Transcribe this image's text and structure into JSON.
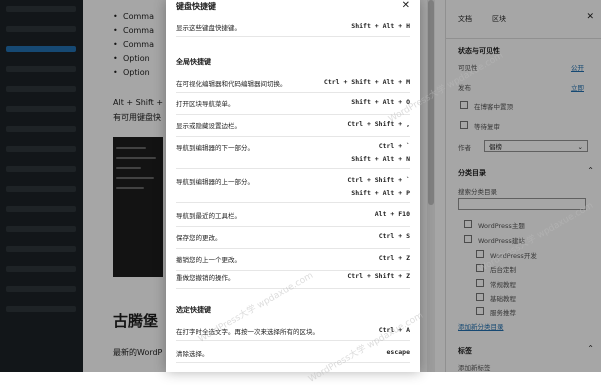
{
  "editor": {
    "bullets": [
      "Comma",
      "Comma",
      "Comma",
      "Option",
      "Option"
    ],
    "line1": "Alt + Shift +",
    "line2": "有可用键盘快",
    "heading": "古腾堡",
    "bottom_text": "最新的WordP"
  },
  "settings": {
    "tab_document": "文档",
    "tab_block": "区块",
    "close": "✕",
    "visibility_section": "状态与可见性",
    "visibility_label": "可见性",
    "visibility_value": "公开",
    "publish_label": "发布",
    "publish_value": "立即",
    "sticky_label": "在博客中置顶",
    "pending_label": "等待复审",
    "author_label": "作者",
    "author_value": "倡榜",
    "categories_section": "分类目录",
    "search_categories": "搜索分类目录",
    "categories": [
      "WordPress主题",
      "WordPress建站",
      "WordPress开发",
      "后台定制",
      "常规教程",
      "基础教程",
      "服务推荐"
    ],
    "add_category": "添加新分类目录",
    "tags_section": "标签",
    "add_tag": "添加新标签"
  },
  "modal": {
    "title": "键盘快捷键",
    "close": "✕",
    "top_shortcut": {
      "desc": "显示这些键盘快捷键。",
      "keys": "Shift + Alt + H"
    },
    "global_section": "全局快捷键",
    "global": [
      {
        "desc": "在可视化编辑器和代码编辑器间切换。",
        "keys": "Ctrl + Shift + Alt + M"
      },
      {
        "desc": "打开区块导航菜单。",
        "keys": "Shift + Alt + O"
      },
      {
        "desc": "显示或隐藏设置边栏。",
        "keys": "Ctrl + Shift + ,"
      },
      {
        "desc": "导航到编辑器的下一部分。",
        "keys": "Ctrl + `",
        "keys2": "Shift + Alt + N"
      },
      {
        "desc": "导航到编辑器的上一部分。",
        "keys": "Ctrl + Shift + `",
        "keys2": "Shift + Alt + P"
      },
      {
        "desc": "导航到最近的工具栏。",
        "keys": "Alt + F10"
      },
      {
        "desc": "保存您的更改。",
        "keys": "Ctrl + S"
      },
      {
        "desc": "撤销您的上一个更改。",
        "keys": "Ctrl + Z"
      },
      {
        "desc": "重做您撤销的操作。",
        "keys": "Ctrl + Shift + Z"
      }
    ],
    "selection_section": "选定快捷键",
    "selection": [
      {
        "desc": "在打字时全选文字。再按一次来选择所有的区块。",
        "keys": "Ctrl + A"
      },
      {
        "desc": "清除选择。",
        "keys": "escape"
      }
    ]
  },
  "watermark": "WordPress大学 wpdaxue.com"
}
